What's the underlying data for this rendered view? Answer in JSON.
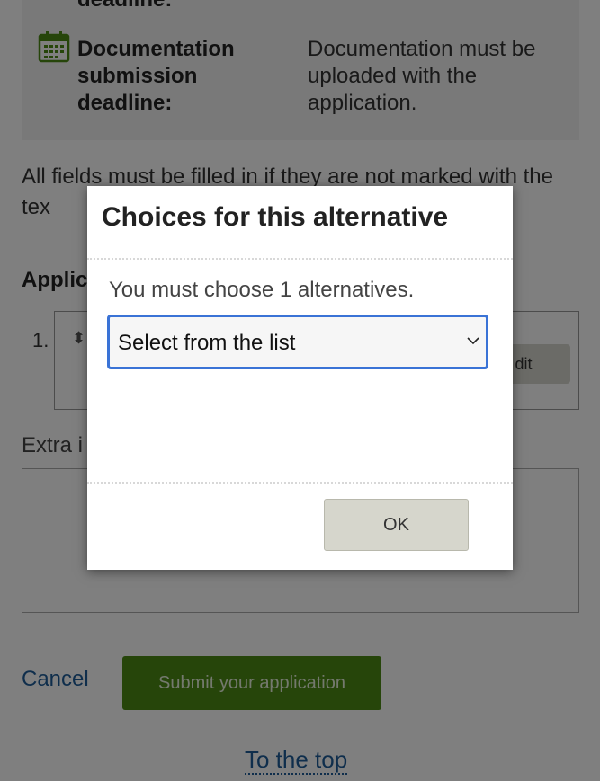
{
  "info": {
    "clipped_label": "deadline:",
    "doc_label": "Documentation submission deadline:",
    "doc_value": "Documentation must be uploaded with the application."
  },
  "required_text": "All fields must be filled in if they are not marked with the tex",
  "applications_heading": "Applic",
  "list": {
    "number": "1.",
    "edit_label": "dit"
  },
  "extra_label": "Extra i",
  "actions": {
    "cancel_label": "Cancel",
    "submit_label": "Submit your application"
  },
  "to_top_label": "To the top",
  "modal": {
    "title": "Choices for this alternative",
    "instruction": "You must choose 1 alternatives.",
    "select_value": "Select from the list",
    "ok_label": "OK"
  },
  "colors": {
    "accent_green": "#4c8a15",
    "link_blue": "#1f5d99",
    "focus_blue": "#3a73d6"
  },
  "icons": [
    "calendar-icon",
    "sort-icon",
    "chevron-down-icon"
  ]
}
